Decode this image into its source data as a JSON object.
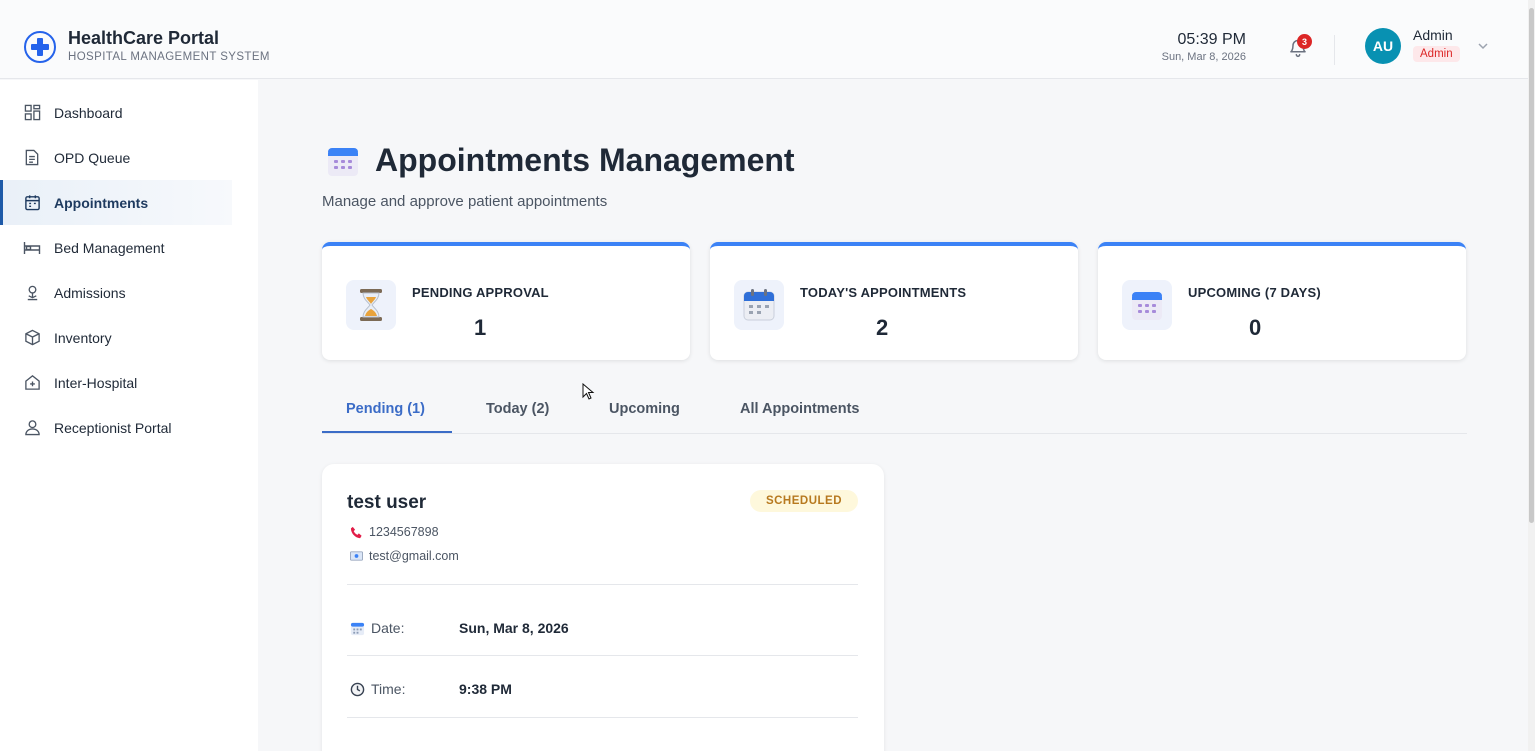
{
  "header": {
    "title": "HealthCare Portal",
    "subtitle": "HOSPITAL MANAGEMENT SYSTEM",
    "time": "05:39 PM",
    "date": "Sun, Mar 8, 2026",
    "notification_count": "3",
    "avatar_initials": "AU",
    "user_name": "Admin",
    "user_role": "Admin"
  },
  "sidebar": {
    "items": [
      {
        "label": "Dashboard",
        "icon": "grid-icon"
      },
      {
        "label": "OPD Queue",
        "icon": "document-icon"
      },
      {
        "label": "Appointments",
        "icon": "calendar-icon",
        "active": true
      },
      {
        "label": "Bed Management",
        "icon": "bed-icon"
      },
      {
        "label": "Admissions",
        "icon": "person-pin-icon"
      },
      {
        "label": "Inventory",
        "icon": "box-icon"
      },
      {
        "label": "Inter-Hospital",
        "icon": "hospital-icon"
      },
      {
        "label": "Receptionist Portal",
        "icon": "user-icon"
      }
    ]
  },
  "page": {
    "title": "Appointments Management",
    "subtitle": "Manage and approve patient appointments"
  },
  "stats": [
    {
      "label": "PENDING APPROVAL",
      "value": "1",
      "icon": "hourglass-icon"
    },
    {
      "label": "TODAY'S APPOINTMENTS",
      "value": "2",
      "icon": "calendar-icon"
    },
    {
      "label": "UPCOMING (7 DAYS)",
      "value": "0",
      "icon": "calendar-icon"
    }
  ],
  "tabs": [
    {
      "label": "Pending (1)",
      "active": true
    },
    {
      "label": "Today (2)"
    },
    {
      "label": "Upcoming"
    },
    {
      "label": "All Appointments"
    }
  ],
  "appointment": {
    "patient_name": "test user",
    "status": "SCHEDULED",
    "phone": "1234567898",
    "email": "test@gmail.com",
    "date_label": "Date:",
    "date_value": "Sun, Mar 8, 2026",
    "time_label": "Time:",
    "time_value": "9:38 PM"
  },
  "colors": {
    "accent": "#3b6cc7",
    "card_top_border": "#3b82f6",
    "avatar": "#0891b2",
    "badge_red": "#dc2626",
    "status_bg": "#fef8dc",
    "status_text": "#b7791f"
  }
}
